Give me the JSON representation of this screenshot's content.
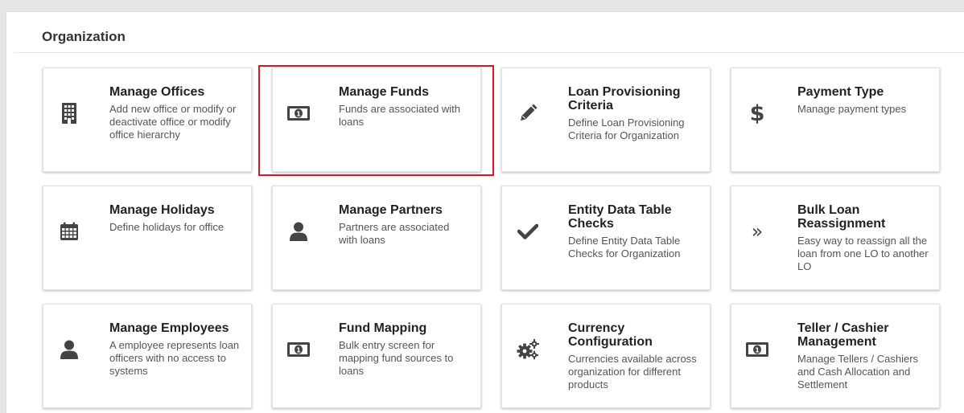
{
  "section": {
    "title": "Organization"
  },
  "cards": [
    {
      "title": "Manage Offices",
      "desc": "Add new office or modify or deactivate office or modify office hierarchy",
      "icon": "building-icon"
    },
    {
      "title": "Manage Funds",
      "desc": "Funds are associated with loans",
      "icon": "money-bill-icon",
      "highlighted": true
    },
    {
      "title": "Loan Provisioning Criteria",
      "desc": "Define Loan Provisioning Criteria for Organization",
      "icon": "pencil-icon"
    },
    {
      "title": "Payment Type",
      "desc": "Manage payment types",
      "icon": "dollar-icon"
    },
    {
      "title": "Manage Holidays",
      "desc": "Define holidays for office",
      "icon": "calendar-icon"
    },
    {
      "title": "Manage Partners",
      "desc": "Partners are associated with loans",
      "icon": "user-icon"
    },
    {
      "title": "Entity Data Table Checks",
      "desc": "Define Entity Data Table Checks for Organization",
      "icon": "check-icon"
    },
    {
      "title": "Bulk Loan Reassignment",
      "desc": "Easy way to reassign all the loan from one LO to another LO",
      "icon": "double-chevron-right-icon"
    },
    {
      "title": "Manage Employees",
      "desc": "A employee represents loan officers with no access to systems",
      "icon": "user-icon"
    },
    {
      "title": "Fund Mapping",
      "desc": "Bulk entry screen for mapping fund sources to loans",
      "icon": "money-bill-icon"
    },
    {
      "title": "Currency Configuration",
      "desc": "Currencies available across organization for different products",
      "icon": "gears-icon"
    },
    {
      "title": "Teller / Cashier Management",
      "desc": "Manage Tellers / Cashiers and Cash Allocation and Settlement",
      "icon": "money-bill-icon"
    }
  ],
  "colors": {
    "highlight": "#e3131b",
    "icon": "#444444"
  }
}
